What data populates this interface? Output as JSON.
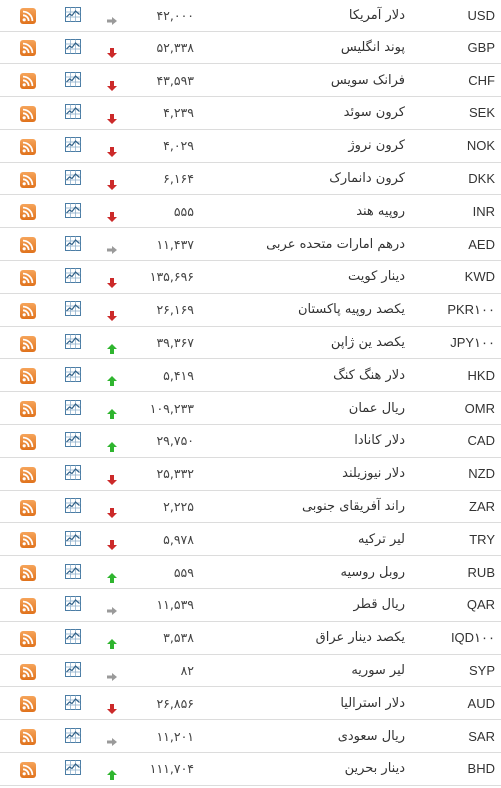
{
  "colors": {
    "up": "#2fb52f",
    "down": "#cc2a2a",
    "same": "#9a9a9a",
    "rss_orange": "#ef8a2c",
    "chart_blue": "#4b7da5",
    "separator": "#dcdcdc"
  },
  "rows": [
    {
      "code": "USD",
      "name": "دلار آمریکا",
      "price": "۴۲,۰۰۰",
      "trend": "same"
    },
    {
      "code": "GBP",
      "name": "پوند انگلیس",
      "price": "۵۲,۳۳۸",
      "trend": "down"
    },
    {
      "code": "CHF",
      "name": "فرانک سویس",
      "price": "۴۳,۵۹۳",
      "trend": "down"
    },
    {
      "code": "SEK",
      "name": "کرون سوئد",
      "price": "۴,۲۳۹",
      "trend": "down"
    },
    {
      "code": "NOK",
      "name": "کرون نروژ",
      "price": "۴,۰۲۹",
      "trend": "down"
    },
    {
      "code": "DKK",
      "name": "کرون دانمارک",
      "price": "۶,۱۶۴",
      "trend": "down"
    },
    {
      "code": "INR",
      "name": "روپیه هند",
      "price": "۵۵۵",
      "trend": "down"
    },
    {
      "code": "AED",
      "name": "درهم امارات متحده عربی",
      "price": "۱۱,۴۳۷",
      "trend": "same"
    },
    {
      "code": "KWD",
      "name": "دینار کویت",
      "price": "۱۳۵,۶۹۶",
      "trend": "down"
    },
    {
      "code": "PKR۱۰۰",
      "name": "یکصد روپیه پاکستان",
      "price": "۲۶,۱۶۹",
      "trend": "down"
    },
    {
      "code": "JPY۱۰۰",
      "name": "یکصد ین ژاپن",
      "price": "۳۹,۳۶۷",
      "trend": "up"
    },
    {
      "code": "HKD",
      "name": "دلار هنگ کنگ",
      "price": "۵,۴۱۹",
      "trend": "up"
    },
    {
      "code": "OMR",
      "name": "ریال عمان",
      "price": "۱۰۹,۲۳۳",
      "trend": "up"
    },
    {
      "code": "CAD",
      "name": "دلار کانادا",
      "price": "۲۹,۷۵۰",
      "trend": "up"
    },
    {
      "code": "NZD",
      "name": "دلار نیوزیلند",
      "price": "۲۵,۳۳۲",
      "trend": "down"
    },
    {
      "code": "ZAR",
      "name": "راند آفریقای جنوبی",
      "price": "۲,۲۲۵",
      "trend": "down"
    },
    {
      "code": "TRY",
      "name": "لیر ترکیه",
      "price": "۵,۹۷۸",
      "trend": "down"
    },
    {
      "code": "RUB",
      "name": "روبل روسیه",
      "price": "۵۵۹",
      "trend": "up"
    },
    {
      "code": "QAR",
      "name": "ریال قطر",
      "price": "۱۱,۵۳۹",
      "trend": "same"
    },
    {
      "code": "IQD۱۰۰",
      "name": "یکصد دینار عراق",
      "price": "۳,۵۳۸",
      "trend": "up"
    },
    {
      "code": "SYP",
      "name": "لیر سوریه",
      "price": "۸۲",
      "trend": "same"
    },
    {
      "code": "AUD",
      "name": "دلار استرالیا",
      "price": "۲۶,۸۵۶",
      "trend": "down"
    },
    {
      "code": "SAR",
      "name": "ریال سعودی",
      "price": "۱۱,۲۰۱",
      "trend": "same"
    },
    {
      "code": "BHD",
      "name": "دینار بحرین",
      "price": "۱۱۱,۷۰۴",
      "trend": "up"
    }
  ]
}
